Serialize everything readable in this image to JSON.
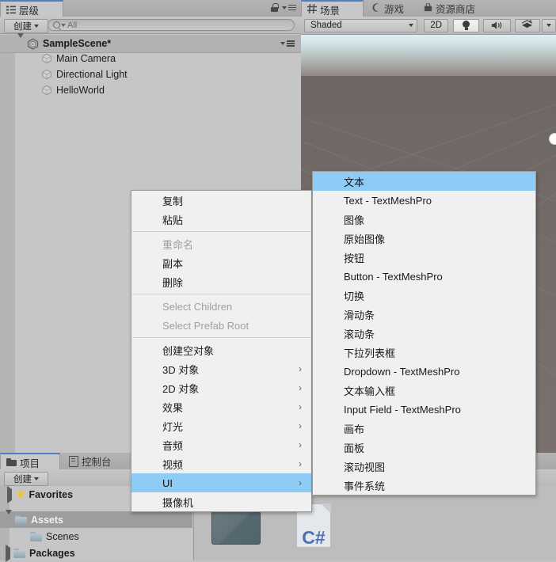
{
  "hierarchy": {
    "tab_label": "层级",
    "tab_icon": "hierarchy-icon",
    "create_button": "创建",
    "search_placeholder": "All",
    "scene_name": "SampleScene*",
    "items": [
      {
        "label": "Main Camera",
        "icon": "gameobject-cube-icon"
      },
      {
        "label": "Directional Light",
        "icon": "gameobject-cube-icon"
      },
      {
        "label": "HelloWorld",
        "icon": "gameobject-cube-icon"
      }
    ]
  },
  "scene_view": {
    "tabs": [
      {
        "label": "场景",
        "icon": "scene-grid-icon",
        "active": true
      },
      {
        "label": "游戏",
        "icon": "game-pad-icon",
        "active": false
      },
      {
        "label": "资源商店",
        "icon": "asset-store-icon",
        "active": false
      }
    ],
    "shading_mode": "Shaded",
    "view_2d_button": "2D",
    "lighting_toggle_icon": "light-bulb-icon",
    "audio_toggle_icon": "speaker-icon",
    "effects_icon": "effects-icon",
    "effects_dropdown_icon": "chevron-down-icon"
  },
  "project_panel": {
    "tabs": [
      {
        "label": "项目",
        "icon": "folder-icon",
        "active": true
      },
      {
        "label": "控制台",
        "icon": "console-icon",
        "active": false
      }
    ],
    "create_button": "创建",
    "tree": [
      {
        "label": "Favorites",
        "icon": "star-icon",
        "expanded": false,
        "depth": 0,
        "selected": false
      },
      {
        "label": "Assets",
        "icon": "folder-icon",
        "expanded": true,
        "depth": 0,
        "selected": true
      },
      {
        "label": "Scenes",
        "icon": "folder-icon",
        "expanded": null,
        "depth": 1,
        "selected": false
      },
      {
        "label": "Packages",
        "icon": "folder-icon",
        "expanded": false,
        "depth": 0,
        "selected": false
      }
    ],
    "assets": [
      {
        "label": "",
        "type": "folder-thumbnail"
      },
      {
        "label": "C#",
        "type": "csharp-script-thumbnail"
      }
    ]
  },
  "context_menu": {
    "items": [
      {
        "label": "复制",
        "type": "item",
        "disabled": false,
        "submenu": false
      },
      {
        "label": "粘贴",
        "type": "item",
        "disabled": false,
        "submenu": false
      },
      {
        "type": "separator"
      },
      {
        "label": "重命名",
        "type": "item",
        "disabled": true,
        "submenu": false
      },
      {
        "label": "副本",
        "type": "item",
        "disabled": false,
        "submenu": false
      },
      {
        "label": "删除",
        "type": "item",
        "disabled": false,
        "submenu": false
      },
      {
        "type": "separator"
      },
      {
        "label": "Select Children",
        "type": "item",
        "disabled": true,
        "submenu": false
      },
      {
        "label": "Select Prefab Root",
        "type": "item",
        "disabled": true,
        "submenu": false
      },
      {
        "type": "separator"
      },
      {
        "label": "创建空对象",
        "type": "item",
        "disabled": false,
        "submenu": false
      },
      {
        "label": "3D 对象",
        "type": "item",
        "disabled": false,
        "submenu": true
      },
      {
        "label": "2D 对象",
        "type": "item",
        "disabled": false,
        "submenu": true
      },
      {
        "label": "效果",
        "type": "item",
        "disabled": false,
        "submenu": true
      },
      {
        "label": "灯光",
        "type": "item",
        "disabled": false,
        "submenu": true
      },
      {
        "label": "音频",
        "type": "item",
        "disabled": false,
        "submenu": true
      },
      {
        "label": "视频",
        "type": "item",
        "disabled": false,
        "submenu": true
      },
      {
        "label": "UI",
        "type": "item",
        "disabled": false,
        "submenu": true,
        "highlighted": true
      },
      {
        "label": "摄像机",
        "type": "item",
        "disabled": false,
        "submenu": false
      }
    ]
  },
  "submenu": {
    "items": [
      {
        "label": "文本",
        "highlighted": true
      },
      {
        "label": "Text - TextMeshPro"
      },
      {
        "label": "图像"
      },
      {
        "label": "原始图像"
      },
      {
        "label": "按钮"
      },
      {
        "label": "Button - TextMeshPro"
      },
      {
        "label": "切换"
      },
      {
        "label": "滑动条"
      },
      {
        "label": "滚动条"
      },
      {
        "label": "下拉列表框"
      },
      {
        "label": "Dropdown - TextMeshPro"
      },
      {
        "label": "文本输入框"
      },
      {
        "label": "Input Field - TextMeshPro"
      },
      {
        "label": "画布"
      },
      {
        "label": "面板"
      },
      {
        "label": "滚动视图"
      },
      {
        "label": "事件系统"
      }
    ]
  },
  "colors": {
    "highlight": "#8ecbf5",
    "menu_bg": "#f0f0f0",
    "panel_bg": "#c2c2c2",
    "active_tab_accent": "#4e7fc4",
    "csharp_blue": "#4a6fb5"
  }
}
